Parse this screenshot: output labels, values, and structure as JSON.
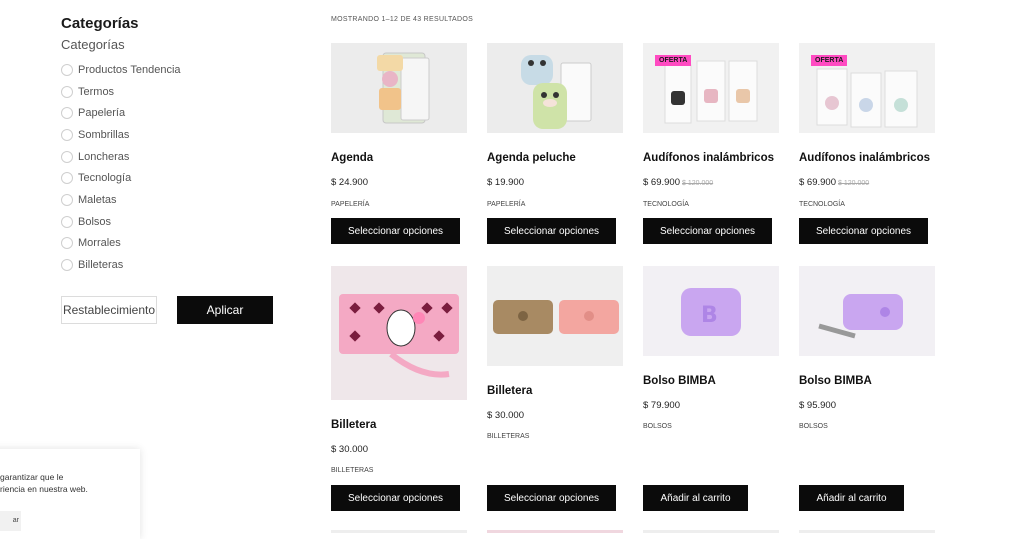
{
  "filters": {
    "title": "Categorías",
    "subtitle": "Categorías",
    "categories": [
      {
        "label": "Productos Tendencia"
      },
      {
        "label": "Termos"
      },
      {
        "label": "Papelería"
      },
      {
        "label": "Sombrillas"
      },
      {
        "label": "Loncheras"
      },
      {
        "label": "Tecnología"
      },
      {
        "label": "Maletas"
      },
      {
        "label": "Bolsos"
      },
      {
        "label": "Morrales"
      },
      {
        "label": "Billeteras"
      }
    ],
    "reset_label": "Restablecimiento",
    "apply_label": "Aplicar"
  },
  "results": {
    "count_text": "MOSTRANDO 1–12 DE 43 RESULTADOS"
  },
  "products": [
    {
      "name": "Agenda",
      "price": "$ 24.900",
      "old_price": "",
      "category": "PAPELERÍA",
      "button": "Seleccionar opciones",
      "badge": ""
    },
    {
      "name": "Agenda peluche",
      "price": "$ 19.900",
      "old_price": "",
      "category": "PAPELERÍA",
      "button": "Seleccionar opciones",
      "badge": ""
    },
    {
      "name": "Audífonos inalámbricos",
      "price": "$ 69.900",
      "old_price": "$ 120.000",
      "category": "TECNOLOGÍA",
      "button": "Seleccionar opciones",
      "badge": "OFERTA"
    },
    {
      "name": "Audífonos inalámbricos",
      "price": "$ 69.900",
      "old_price": "$ 120.000",
      "category": "TECNOLOGÍA",
      "button": "Seleccionar opciones",
      "badge": "OFERTA"
    },
    {
      "name": "Billetera",
      "price": "$ 30.000",
      "old_price": "",
      "category": "BILLETERAS",
      "button": "Seleccionar opciones",
      "badge": ""
    },
    {
      "name": "Billetera",
      "price": "$ 30.000",
      "old_price": "",
      "category": "BILLETERAS",
      "button": "Seleccionar opciones",
      "badge": ""
    },
    {
      "name": "Bolso BIMBA",
      "price": "$ 79.900",
      "old_price": "",
      "category": "BOLSOS",
      "button": "Añadir al carrito",
      "badge": ""
    },
    {
      "name": "Bolso BIMBA",
      "price": "$ 95.900",
      "old_price": "",
      "category": "BOLSOS",
      "button": "Añadir al carrito",
      "badge": ""
    }
  ],
  "cookie": {
    "line1": "garantizar que le",
    "line2": "riencia en nuestra web.",
    "button": "ar"
  },
  "colors": {
    "accent": "#0b0b0b",
    "badge": "#ff4bc2"
  }
}
